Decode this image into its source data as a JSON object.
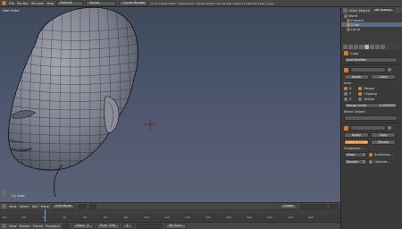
{
  "topbar": {
    "menus": [
      "File",
      "Render",
      "Window",
      "Help"
    ],
    "layout": "Default",
    "scene": "Scene",
    "engine": "Cycles Render",
    "stats": "v2.72 | Verts:30677 | Objects:0/1 | Faces:29444 | Tris:61,436 | Mem:17.53M (30.71M) | Cube",
    "view_label": "View",
    "search_label": "Search",
    "all_scenes": "All Scenes"
  },
  "viewport": {
    "view_name": "User Ortho",
    "object_label": "(1) Cube"
  },
  "viewport_header": {
    "items": [
      "View",
      "Select",
      "Add",
      "Mesh"
    ],
    "mode": "Edit Mode",
    "pivot": "Global"
  },
  "timeline": {
    "ticks": [
      "-40",
      "-20",
      "0",
      "20",
      "40",
      "60",
      "80",
      "100",
      "120",
      "140",
      "160",
      "180",
      "200",
      "220",
      "240",
      "260"
    ],
    "frame_marker": "0"
  },
  "timeline_header": {
    "items": [
      "View",
      "Marker",
      "Frame",
      "Playback"
    ],
    "start_label": "Start:",
    "start_value": "1",
    "end_label": "End:",
    "end_value": "250",
    "current_frame": "1",
    "sync": "No Sync"
  },
  "outliner": {
    "header_view": "View",
    "header_search": "Search",
    "header_scene": "All Scenes",
    "items": [
      "World",
      "Camera",
      "Cube",
      "Lamp"
    ]
  },
  "properties": {
    "object_name": "Cube",
    "add_modifier": "Add Modifier",
    "mirror_apply": "Apply",
    "mirror_copy": "Copy",
    "axis_label": "Axis:",
    "x_label": "X",
    "y_label": "Y",
    "z_label": "Z",
    "merge_label": "Merge",
    "clipping_label": "Clipping",
    "vertex_groups_label": "Vertex",
    "merge_limit_label": "Merge Limit:",
    "merge_limit_value": "0.001000",
    "mirror_object_label": "Mirror Object:",
    "subsurf_apply": "Apply",
    "subsurf_copy": "Copy",
    "catmull_label": "Catmull-Clark",
    "simple_label": "Simple",
    "subdivisions_label": "Subdivisio...",
    "view_label": "View:",
    "view_value": "1",
    "render_label": "Render:",
    "render_value": "2",
    "subdivide_uvs_label": "Subdivide...",
    "optimal_label": "Optimal..."
  },
  "colors": {
    "viewport_top": "#3f4a5c",
    "viewport_bottom": "#5a6276",
    "accent_orange": "#d87a1f",
    "selection_blue": "#5a6a8a"
  }
}
